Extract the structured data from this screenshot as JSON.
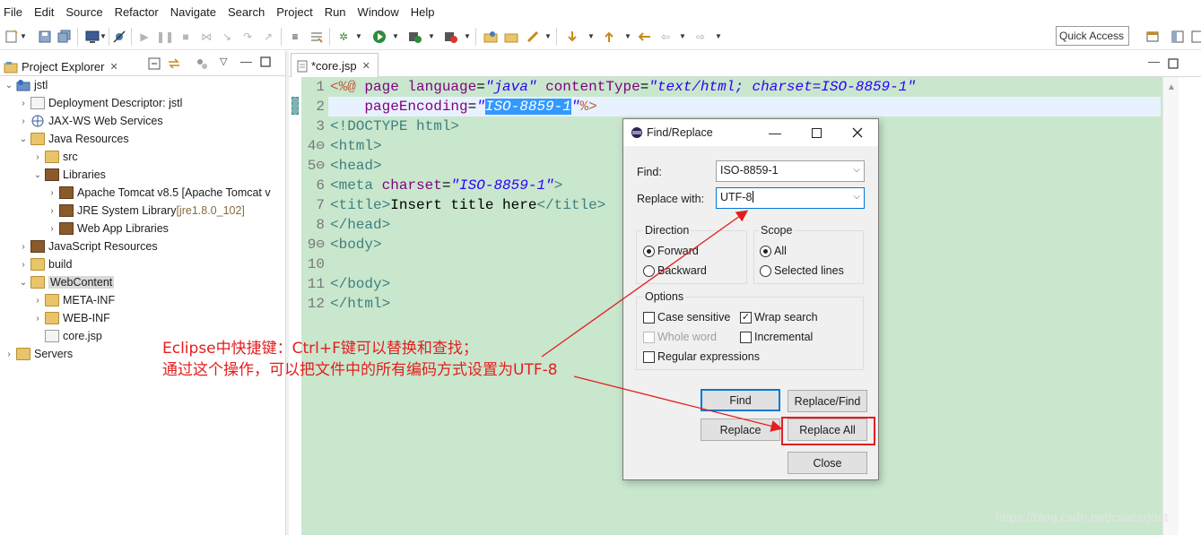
{
  "menubar": {
    "items": [
      "File",
      "Edit",
      "Source",
      "Refactor",
      "Navigate",
      "Search",
      "Project",
      "Run",
      "Window",
      "Help"
    ]
  },
  "toolbar": {
    "quick_access_label": "Quick Access"
  },
  "explorer": {
    "tab_label": "Project Explorer",
    "close_glyph": "✕",
    "tree": [
      {
        "label": "jstl",
        "decor": "",
        "arrow": "⌄",
        "icon": "project-icon"
      },
      {
        "label": "Deployment Descriptor: jstl",
        "decor": "",
        "arrow": "›",
        "icon": "descriptor-icon"
      },
      {
        "label": "JAX-WS Web Services",
        "decor": "",
        "arrow": "›",
        "icon": "webservice-icon"
      },
      {
        "label": "Java Resources",
        "decor": "",
        "arrow": "⌄",
        "icon": "java-resources-icon"
      },
      {
        "label": "src",
        "decor": "",
        "arrow": "›",
        "icon": "package-folder-icon"
      },
      {
        "label": "Libraries",
        "decor": "",
        "arrow": "⌄",
        "icon": "libraries-icon"
      },
      {
        "label": "Apache Tomcat v8.5 [Apache Tomcat v",
        "decor": "",
        "arrow": "›",
        "icon": "library-jar-icon"
      },
      {
        "label": "JRE System Library ",
        "decor": "[jre1.8.0_102]",
        "arrow": "›",
        "icon": "library-jar-icon"
      },
      {
        "label": "Web App Libraries",
        "decor": "",
        "arrow": "›",
        "icon": "library-jar-icon"
      },
      {
        "label": "JavaScript Resources",
        "decor": "",
        "arrow": "›",
        "icon": "js-resources-icon"
      },
      {
        "label": "build",
        "decor": "",
        "arrow": "›",
        "icon": "folder-icon"
      },
      {
        "label": "WebContent",
        "decor": "",
        "arrow": "⌄",
        "icon": "folder-open-icon"
      },
      {
        "label": "META-INF",
        "decor": "",
        "arrow": "›",
        "icon": "folder-icon"
      },
      {
        "label": "WEB-INF",
        "decor": "",
        "arrow": "›",
        "icon": "folder-icon"
      },
      {
        "label": "core.jsp",
        "decor": "",
        "arrow": "",
        "icon": "jsp-file-icon"
      },
      {
        "label": "Servers",
        "decor": "",
        "arrow": "›",
        "icon": "folder-icon"
      }
    ]
  },
  "editor": {
    "tab_label": "*core.jsp",
    "line_numbers": [
      "1",
      "2",
      "3",
      "4⊖",
      "5⊖",
      "6",
      "7",
      "8",
      "9⊖",
      "10",
      "11",
      "12"
    ],
    "lines": [
      {
        "parts": [
          [
            "jsp",
            "<%@ "
          ],
          [
            "attr",
            "page "
          ],
          [
            "attr",
            "language"
          ],
          [
            "txt",
            "="
          ],
          [
            "val",
            "\"java\""
          ],
          [
            "txt",
            " "
          ],
          [
            "attr",
            "contentType"
          ],
          [
            "txt",
            "="
          ],
          [
            "val",
            "\"text/html; charset=ISO-8859-1\""
          ]
        ]
      },
      {
        "parts": [
          [
            "txt",
            "    "
          ],
          [
            "attr",
            "pageEncoding"
          ],
          [
            "txt",
            "="
          ],
          [
            "val",
            "\""
          ],
          [
            "sel",
            "ISO-8859-1"
          ],
          [
            "val",
            "\""
          ],
          [
            "jsp",
            "%>"
          ]
        ]
      },
      {
        "parts": [
          [
            "tag",
            "<!DOCTYPE html>"
          ]
        ]
      },
      {
        "parts": [
          [
            "tag",
            "<html>"
          ]
        ]
      },
      {
        "parts": [
          [
            "tag",
            "<head>"
          ]
        ]
      },
      {
        "parts": [
          [
            "tag",
            "<meta "
          ],
          [
            "attr",
            "charset"
          ],
          [
            "txt",
            "="
          ],
          [
            "val",
            "\"ISO-8859-1\""
          ],
          [
            "tag",
            ">"
          ]
        ]
      },
      {
        "parts": [
          [
            "tag",
            "<title>"
          ],
          [
            "txt",
            "Insert title here"
          ],
          [
            "tag",
            "</title>"
          ]
        ]
      },
      {
        "parts": [
          [
            "tag",
            "</head>"
          ]
        ]
      },
      {
        "parts": [
          [
            "tag",
            "<body>"
          ]
        ]
      },
      {
        "parts": [
          [
            "txt",
            ""
          ]
        ]
      },
      {
        "parts": [
          [
            "tag",
            "</body>"
          ]
        ]
      },
      {
        "parts": [
          [
            "tag",
            "</html>"
          ]
        ]
      }
    ]
  },
  "annotation": {
    "line1": "Eclipse中快捷键：Ctrl+F键可以替换和查找；",
    "line2": "通过这个操作，可以把文件中的所有编码方式设置为UTF-8",
    "color": "#e31e1e"
  },
  "dialog": {
    "title": "Find/Replace",
    "find_label": "Find:",
    "find_value": "ISO-8859-1",
    "replace_label": "Replace with:",
    "replace_value": "UTF-8",
    "direction_title": "Direction",
    "forward_label": "Forward",
    "backward_label": "Backward",
    "direction_selected": "Forward",
    "scope_title": "Scope",
    "all_label": "All",
    "selected_lines_label": "Selected lines",
    "scope_selected": "All",
    "options_title": "Options",
    "case_sensitive_label": "Case sensitive",
    "case_sensitive_checked": false,
    "wrap_search_label": "Wrap search",
    "wrap_search_checked": true,
    "whole_word_label": "Whole word",
    "whole_word_enabled": false,
    "incremental_label": "Incremental",
    "incremental_checked": false,
    "regex_label": "Regular expressions",
    "regex_checked": false,
    "find_button": "Find",
    "replace_find_button": "Replace/Find",
    "replace_button": "Replace",
    "replace_all_button": "Replace All",
    "close_button": "Close"
  },
  "watermark": "https://blog.csdn.net/csucsgoat",
  "colors": {
    "editor_bg": "#c9e7cd",
    "highlight": "#e31e1e",
    "selection": "#3399ff"
  }
}
